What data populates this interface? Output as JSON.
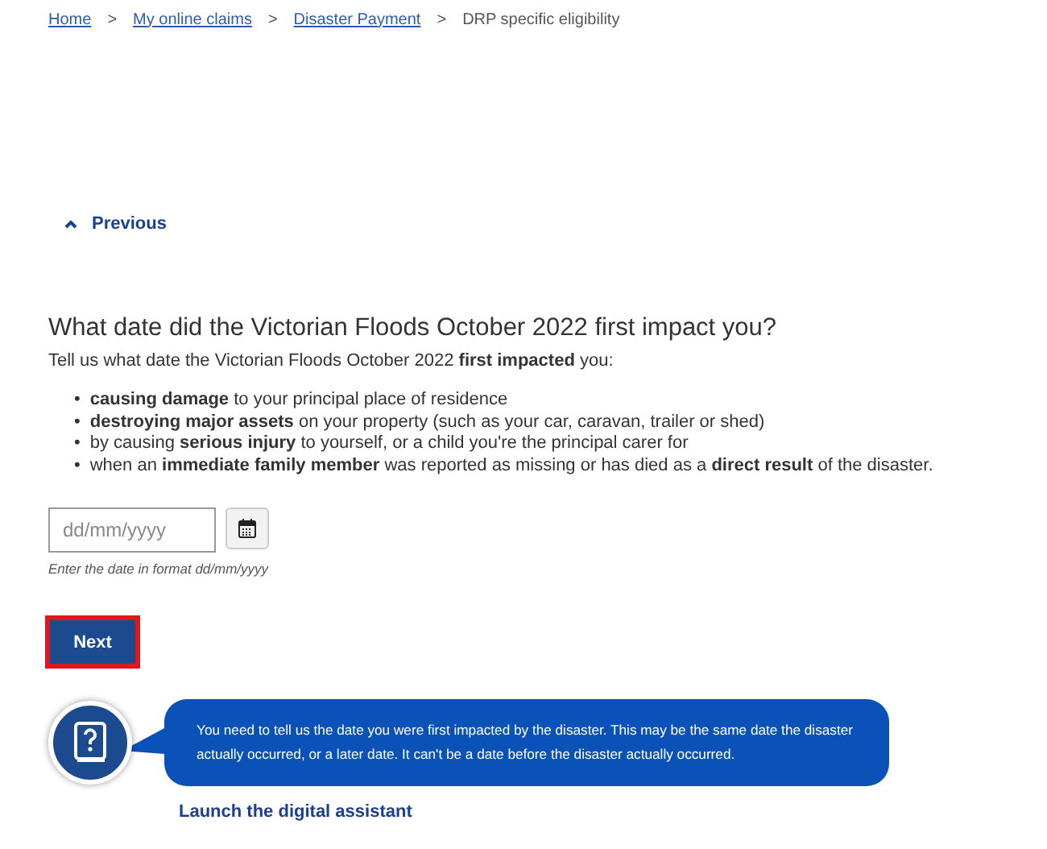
{
  "breadcrumb": [
    {
      "label": "Home",
      "kind": "link"
    },
    {
      "label": "My online claims",
      "kind": "link"
    },
    {
      "label": "Disaster Payment",
      "kind": "link"
    },
    {
      "label": "DRP specific eligibility",
      "kind": "current"
    }
  ],
  "breadcrumb_separator": ">",
  "previous_link": "Previous",
  "question": {
    "title": "What date did the Victorian Floods October 2022 first impact you?",
    "intro": "Tell us what date the Victorian Floods October 2022 **first impacted** you:",
    "bullet": "•",
    "items": [
      "**causing damage** to your principal place of residence",
      "**destroying major assets** on your property (such as your car, caravan, trailer or shed)",
      "by causing **serious injury** to yourself, or a child you're the principal carer for",
      "when an **immediate family member** was reported as missing or has died as a **direct result** of the disaster."
    ]
  },
  "date_field": {
    "placeholder": "dd/mm/yyyy",
    "hint": "Enter the date in format dd/mm/yyyy"
  },
  "next_button": {
    "label": "Next",
    "focused": true
  },
  "assistant": {
    "message": "You need to tell us the date you were first impacted by the disaster. This may be the same date the disaster actually occurred, or a later date. It can't be a date before the disaster actually occurred.",
    "link": "Launch the digital assistant"
  }
}
